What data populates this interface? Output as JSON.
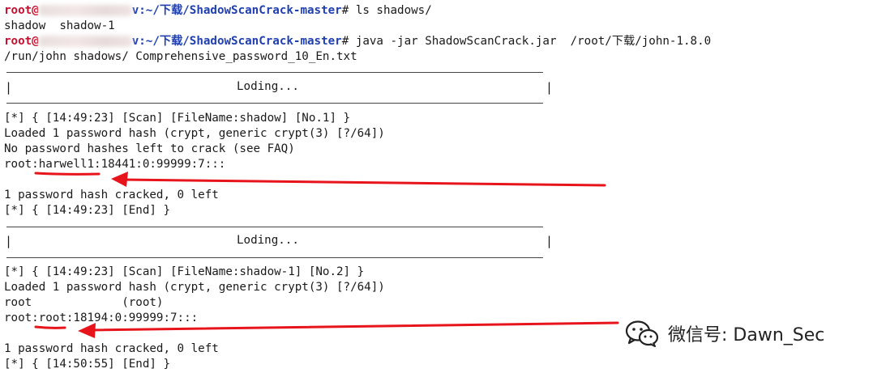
{
  "terminal": {
    "prompt_user": "root@",
    "prompt_path": "v:~/下载/ShadowScanCrack-master",
    "prompt_suffix": "# ",
    "lines": {
      "cmd1": "ls shadows/",
      "out1": "shadow  shadow-1",
      "cmd2": "java -jar ShadowScanCrack.jar  /root/下载/john-1.8.0",
      "cmd2_cont": "/run/john shadows/ Comprehensive_password_10_En.txt",
      "pipe": "|",
      "loading": "Loding...",
      "scan1": "[*] { [14:49:23] [Scan] [FileName:shadow] [No.1] }",
      "loaded1": "Loaded 1 password hash (crypt, generic crypt(3) [?/64])",
      "nohash": "No password hashes left to crack (see FAQ)",
      "result1": "root:harwell1:18441:0:99999:7:::",
      "cracked1": "1 password hash cracked, 0 left",
      "end1": "[*] { [14:49:23] [End] }",
      "scan2": "[*] { [14:49:23] [Scan] [FileName:shadow-1] [No.2] }",
      "loaded2": "Loaded 1 password hash (crypt, generic crypt(3) [?/64])",
      "rootline": "root             (root)",
      "result2": "root:root:18194:0:99999:7:::",
      "cracked2": "1 password hash cracked, 0 left",
      "end2": "[*] { [14:50:55] [End] }"
    }
  },
  "watermark": {
    "text": "微信号: Dawn_Sec",
    "icon": "wechat-icon"
  },
  "colors": {
    "prompt_user": "#c8102e",
    "prompt_path": "#1f3fb0",
    "arrow": "#e8141b"
  }
}
